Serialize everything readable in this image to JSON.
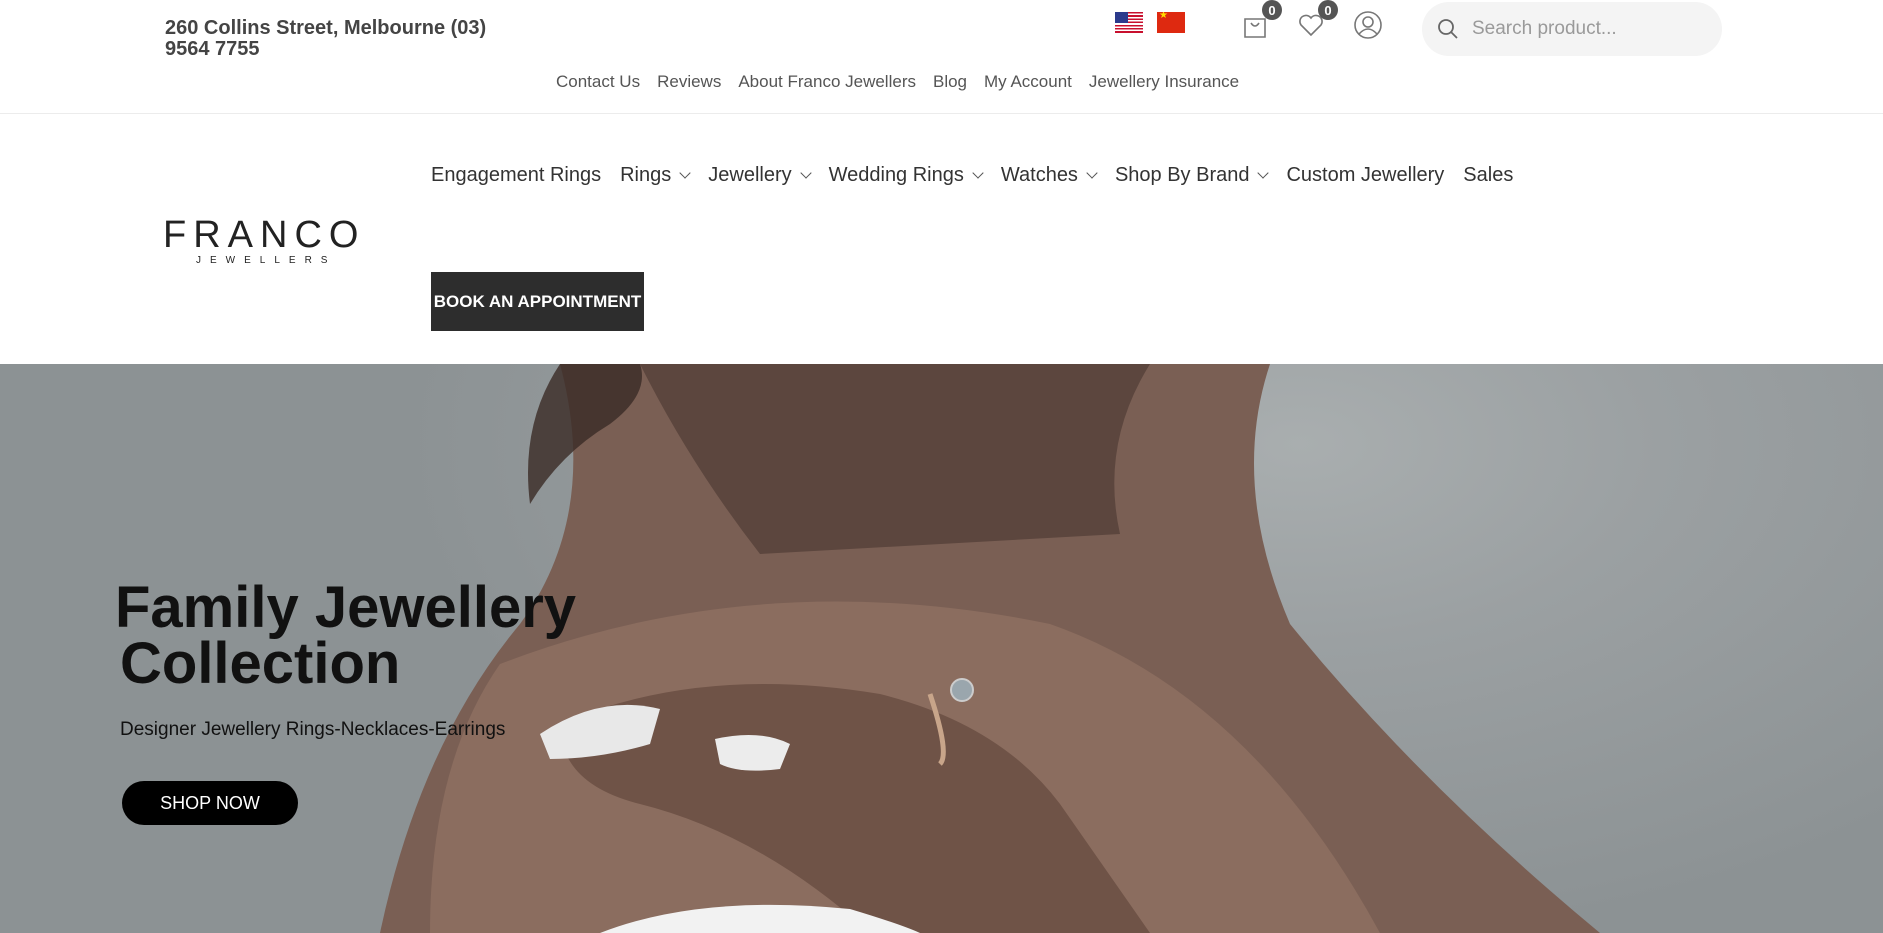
{
  "topbar": {
    "address": "260 Collins Street, Melbourne (03) 9564 7755",
    "cart_count": "0",
    "wishlist_count": "0",
    "search_placeholder": "Search product...",
    "links": [
      "Contact Us",
      "Reviews",
      "About Franco Jewellers",
      "Blog",
      "My Account",
      "Jewellery Insurance"
    ]
  },
  "logo": {
    "name": "FRANCO",
    "tagline": "JEWELLERS"
  },
  "nav": {
    "items": [
      {
        "label": "Engagement Rings",
        "dropdown": false
      },
      {
        "label": "Rings",
        "dropdown": true
      },
      {
        "label": "Jewellery",
        "dropdown": true
      },
      {
        "label": "Wedding Rings",
        "dropdown": true
      },
      {
        "label": "Watches",
        "dropdown": true
      },
      {
        "label": "Shop By Brand",
        "dropdown": true
      },
      {
        "label": "Custom Jewellery",
        "dropdown": false
      },
      {
        "label": "Sales",
        "dropdown": false
      }
    ],
    "book_label": "BOOK AN APPOINTMENT"
  },
  "hero": {
    "title_line1": "Family Jewellery",
    "title_line2": "Collection",
    "subtitle": "Designer Jewellery Rings-Necklaces-Earrings",
    "cta": "SHOP NOW"
  },
  "icons": [
    "flag-us-icon",
    "flag-cn-icon",
    "cart-icon",
    "heart-icon",
    "user-icon",
    "search-icon",
    "chevron-down-icon"
  ],
  "colors": {
    "accent_dark": "#2d2d2d",
    "badge": "#555555",
    "hero_bg": "#9ba0a2"
  }
}
